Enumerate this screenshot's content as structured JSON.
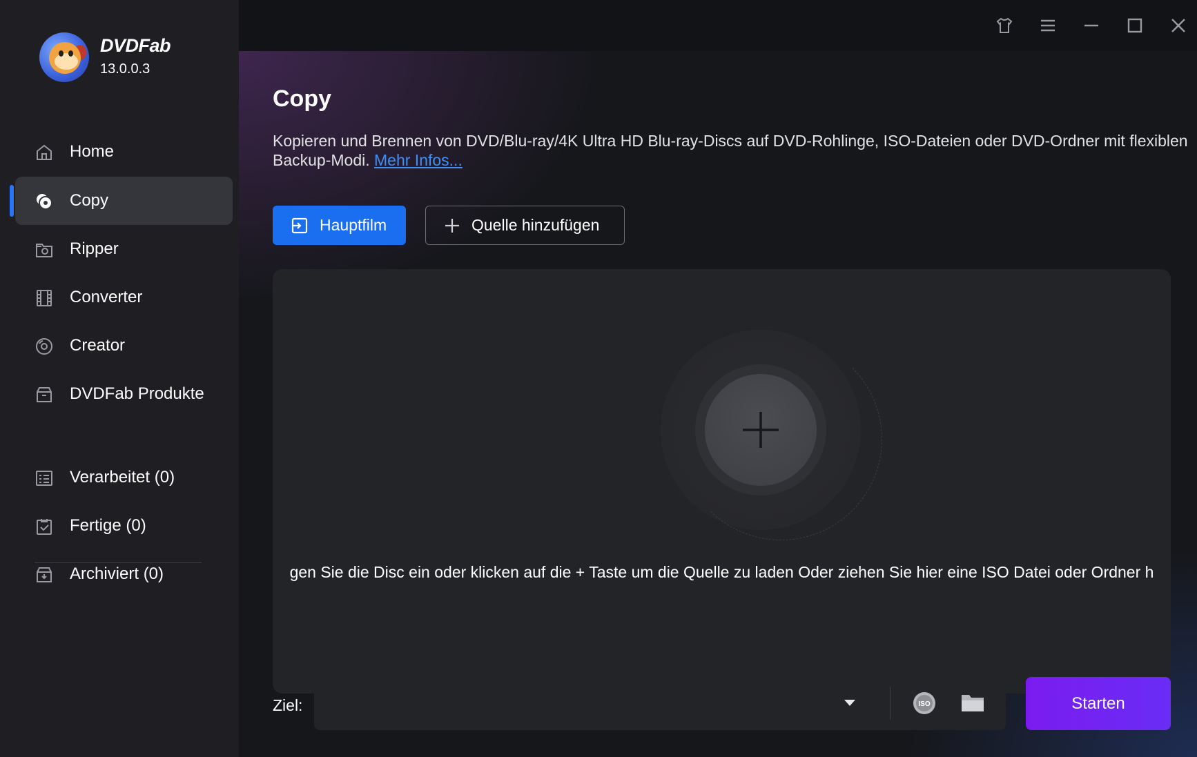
{
  "app": {
    "name": "DVDFab",
    "version": "13.0.0.3"
  },
  "sidebar": {
    "items": [
      {
        "label": "Home",
        "icon": "home-icon"
      },
      {
        "label": "Copy",
        "icon": "copy-disc-icon",
        "active": true
      },
      {
        "label": "Ripper",
        "icon": "ripper-icon"
      },
      {
        "label": "Converter",
        "icon": "film-icon"
      },
      {
        "label": "Creator",
        "icon": "creator-disc-icon"
      },
      {
        "label": "DVDFab Produkte",
        "icon": "products-box-icon"
      }
    ],
    "queue": [
      {
        "label": "Verarbeitet (0)",
        "icon": "processing-list-icon"
      },
      {
        "label": "Fertige (0)",
        "icon": "finished-clipboard-icon"
      },
      {
        "label": "Archiviert (0)",
        "icon": "archive-box-icon"
      }
    ]
  },
  "titlebar": {
    "icons": [
      "skin-shirt-icon",
      "menu-icon",
      "minimize-icon",
      "maximize-icon",
      "close-icon"
    ]
  },
  "main": {
    "title": "Copy",
    "description": "Kopieren und Brennen von DVD/Blu-ray/4K Ultra HD Blu-ray-Discs auf DVD-Rohlinge, ISO-Dateien oder DVD-Ordner mit flexiblen Backup-Modi.",
    "more_info_link": "Mehr Infos...",
    "mode_button": "Hauptfilm",
    "add_source_button": "Quelle hinzufügen",
    "drop_text": "gen Sie die Disc ein oder klicken auf die + Taste um die Quelle zu laden Oder ziehen Sie hier eine ISO Datei oder Ordner h",
    "target_label": "Ziel:",
    "target_value": "",
    "start_button": "Starten"
  },
  "colors": {
    "accent_blue": "#1a6ef0",
    "start_purple": "#7a1cf0",
    "link": "#3f8ff7",
    "sidebar_bg": "#1f1f23",
    "active_item_bg": "#35363c"
  }
}
